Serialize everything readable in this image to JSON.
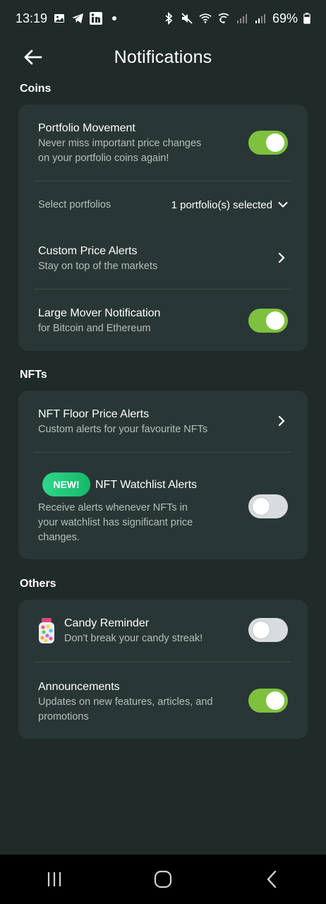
{
  "status_bar": {
    "time": "13:19",
    "battery": "69%"
  },
  "header": {
    "title": "Notifications"
  },
  "sections": {
    "coins": "Coins",
    "nfts": "NFTs",
    "others": "Others"
  },
  "coins": {
    "portfolio_movement": {
      "title": "Portfolio Movement",
      "subtitle_line1": "Never miss important price changes",
      "subtitle_line2": "on your portfolio coins again!",
      "enabled": true
    },
    "select_portfolios": {
      "label": "Select portfolios",
      "value": "1 portfolio(s) selected"
    },
    "custom_price_alerts": {
      "title": "Custom Price Alerts",
      "subtitle": "Stay on top of the markets"
    },
    "large_mover": {
      "title": "Large Mover Notification",
      "subtitle": "for Bitcoin and Ethereum",
      "enabled": true
    }
  },
  "nfts": {
    "floor_price_alerts": {
      "title": "NFT Floor Price Alerts",
      "subtitle": "Custom alerts for your favourite NFTs"
    },
    "watchlist_alerts": {
      "badge": "NEW!",
      "title": "NFT Watchlist Alerts",
      "subtitle_line1": "Receive alerts whenever NFTs in",
      "subtitle_line2": "your watchlist has significant price",
      "subtitle_line3": "changes.",
      "enabled": false
    }
  },
  "others": {
    "candy_reminder": {
      "title": "Candy Reminder",
      "subtitle": "Don't break your candy streak!",
      "icon": "candy-jar-icon",
      "enabled": false
    },
    "announcements": {
      "title": "Announcements",
      "subtitle_line1": "Updates on new features, articles, and",
      "subtitle_line2": "promotions",
      "enabled": true
    }
  },
  "colors": {
    "background": "#1f2a29",
    "card": "#283735",
    "toggle_on": "#7ec13e",
    "toggle_off": "#d9dcdf",
    "badge": "#17b869"
  }
}
